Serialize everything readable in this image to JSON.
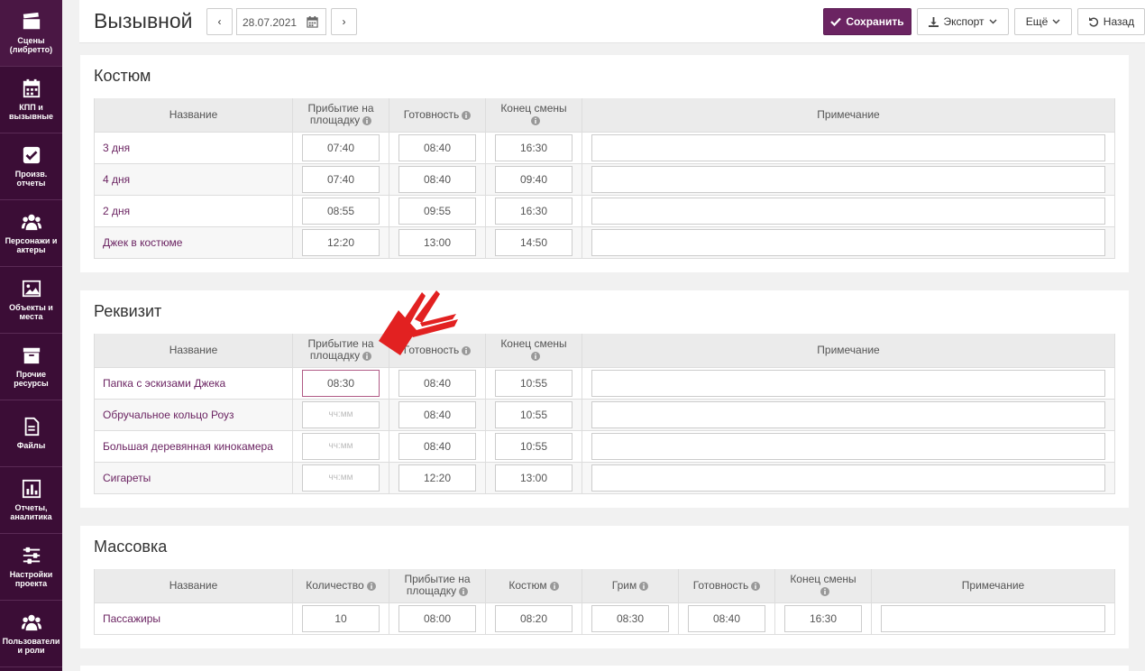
{
  "sidebar": {
    "items": [
      {
        "label": "Сцены (либретто)",
        "icon": "clapperboard-icon"
      },
      {
        "label": "КПП и вызывные",
        "icon": "calendar-icon"
      },
      {
        "label": "Произв. отчеты",
        "icon": "checkbox-icon"
      },
      {
        "label": "Персонажи и актеры",
        "icon": "users-icon"
      },
      {
        "label": "Объекты и места",
        "icon": "image-icon"
      },
      {
        "label": "Прочие ресурсы",
        "icon": "archive-icon"
      },
      {
        "label": "Файлы",
        "icon": "file-icon"
      },
      {
        "label": "Отчеты, аналитика",
        "icon": "bar-chart-icon"
      },
      {
        "label": "Настройки проекта",
        "icon": "sliders-icon"
      },
      {
        "label": "Пользователи и роли",
        "icon": "users-icon"
      }
    ]
  },
  "header": {
    "title": "Вызывной",
    "date": "28.07.2021",
    "prev_label": "‹",
    "next_label": "›",
    "save_label": "Сохранить",
    "export_label": "Экспорт",
    "more_label": "Ещё",
    "back_label": "Назад"
  },
  "costume": {
    "title": "Костюм",
    "columns": {
      "name": "Название",
      "arrival": "Прибытие на площадку",
      "ready": "Готовность",
      "end": "Конец смены",
      "note": "Примечание"
    },
    "rows": [
      {
        "name": "3 дня",
        "arrival": "07:40",
        "ready": "08:40",
        "end": "16:30"
      },
      {
        "name": "4 дня",
        "arrival": "07:40",
        "ready": "08:40",
        "end": "09:40"
      },
      {
        "name": "2 дня",
        "arrival": "08:55",
        "ready": "09:55",
        "end": "16:30"
      },
      {
        "name": "Джек в костюме",
        "arrival": "12:20",
        "ready": "13:00",
        "end": "14:50"
      }
    ]
  },
  "props": {
    "title": "Реквизит",
    "columns": {
      "name": "Название",
      "arrival": "Прибытие на площадку",
      "ready": "Готовность",
      "end": "Конец смены",
      "note": "Примечание"
    },
    "placeholder": "чч:мм",
    "rows": [
      {
        "name": "Папка с эскизами Джека",
        "arrival": "08:30",
        "ready": "08:40",
        "end": "10:55"
      },
      {
        "name": "Обручальное кольцо Роуз",
        "arrival": "",
        "ready": "08:40",
        "end": "10:55"
      },
      {
        "name": "Большая деревянная кинокамера",
        "arrival": "",
        "ready": "08:40",
        "end": "10:55"
      },
      {
        "name": "Сигареты",
        "arrival": "",
        "ready": "12:20",
        "end": "13:00"
      }
    ]
  },
  "extras": {
    "title": "Массовка",
    "columns": {
      "name": "Название",
      "count": "Количество",
      "arrival": "Прибытие на площадку",
      "costume": "Костюм",
      "makeup": "Грим",
      "ready": "Готовность",
      "end": "Конец смены",
      "note": "Примечание"
    },
    "rows": [
      {
        "name": "Пассажиры",
        "count": "10",
        "arrival": "08:00",
        "costume": "08:20",
        "makeup": "08:30",
        "ready": "08:40",
        "end": "16:30"
      }
    ]
  },
  "colors": {
    "sidebar": "#3b0d36",
    "accent": "#6b2462",
    "arrow": "#e02020"
  }
}
